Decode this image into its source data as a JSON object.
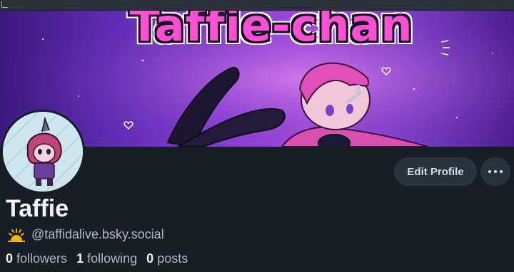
{
  "banner": {
    "title": "Taffie-chan"
  },
  "profile": {
    "display_name": "Taffie",
    "handle": "@taffidalive.bsky.social",
    "handle_icon": "sun-emoji-icon",
    "avatar_icon": "avatar-image"
  },
  "stats": {
    "followers_count": "0",
    "followers_label": "followers",
    "following_count": "1",
    "following_label": "following",
    "posts_count": "0",
    "posts_label": "posts"
  },
  "actions": {
    "edit_profile_label": "Edit Profile",
    "more_icon": "more-options-icon"
  },
  "colors": {
    "background": "#161e27",
    "button_bg": "#283340",
    "banner_title": "#ff4fd2",
    "muted_text": "#aeb8c4"
  }
}
